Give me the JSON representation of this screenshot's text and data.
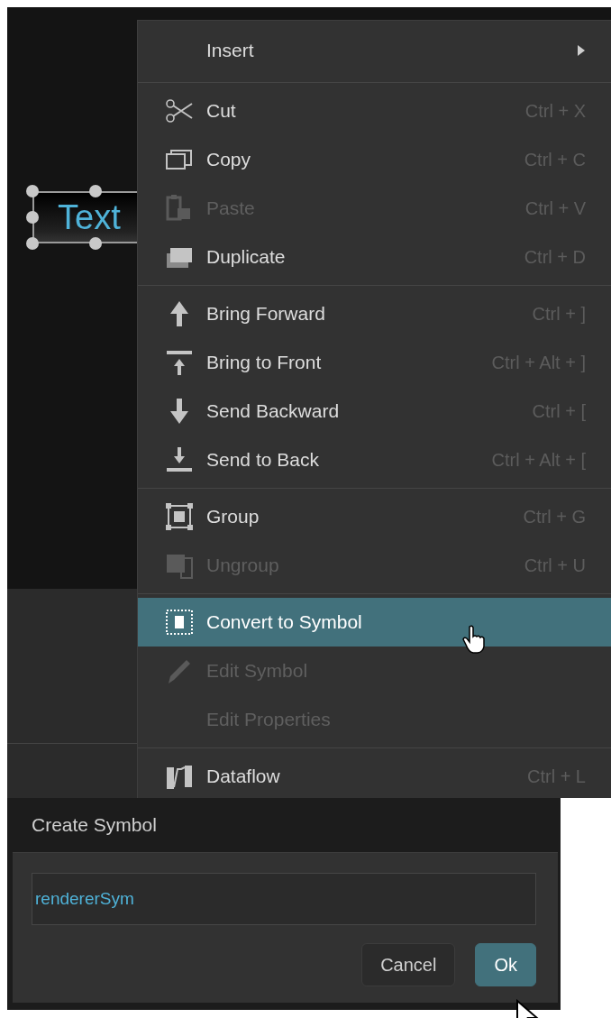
{
  "canvas": {
    "element_text": "Text"
  },
  "context_menu": {
    "sections": [
      [
        {
          "label": "Insert",
          "disabled": false,
          "selected": false,
          "submenu": true
        }
      ],
      [
        {
          "label": "Cut",
          "shortcut": "Ctrl + X",
          "disabled": false,
          "selected": false,
          "submenu": false
        },
        {
          "label": "Copy",
          "shortcut": "Ctrl + C",
          "disabled": false,
          "selected": false,
          "submenu": false
        },
        {
          "label": "Paste",
          "shortcut": "Ctrl + V",
          "disabled": true,
          "selected": false,
          "submenu": false
        },
        {
          "label": "Duplicate",
          "shortcut": "Ctrl + D",
          "disabled": false,
          "selected": false,
          "submenu": false
        }
      ],
      [
        {
          "label": "Bring Forward",
          "shortcut": "Ctrl + ]",
          "disabled": false,
          "selected": false,
          "submenu": false
        },
        {
          "label": "Bring to Front",
          "shortcut": "Ctrl + Alt + ]",
          "disabled": false,
          "selected": false,
          "submenu": false
        },
        {
          "label": "Send Backward",
          "shortcut": "Ctrl + [",
          "disabled": false,
          "selected": false,
          "submenu": false
        },
        {
          "label": "Send to Back",
          "shortcut": "Ctrl + Alt + [",
          "disabled": false,
          "selected": false,
          "submenu": false
        }
      ],
      [
        {
          "label": "Group",
          "shortcut": "Ctrl + G",
          "disabled": false,
          "selected": false,
          "submenu": false
        },
        {
          "label": "Ungroup",
          "shortcut": "Ctrl + U",
          "disabled": true,
          "selected": false,
          "submenu": false
        }
      ],
      [
        {
          "label": "Convert to Symbol",
          "disabled": false,
          "selected": true,
          "submenu": false
        },
        {
          "label": "Edit Symbol",
          "disabled": true,
          "selected": false,
          "submenu": false
        },
        {
          "label": "Edit Properties",
          "disabled": true,
          "selected": false,
          "submenu": false
        }
      ],
      [
        {
          "label": "Dataflow",
          "shortcut": "Ctrl + L",
          "disabled": false,
          "selected": false,
          "submenu": false
        }
      ]
    ]
  },
  "dialog": {
    "title": "Create Symbol",
    "name_value": "rendererSym",
    "buttons": [
      {
        "label": "Cancel",
        "kind": "secondary"
      },
      {
        "label": "Ok",
        "kind": "primary"
      }
    ]
  }
}
